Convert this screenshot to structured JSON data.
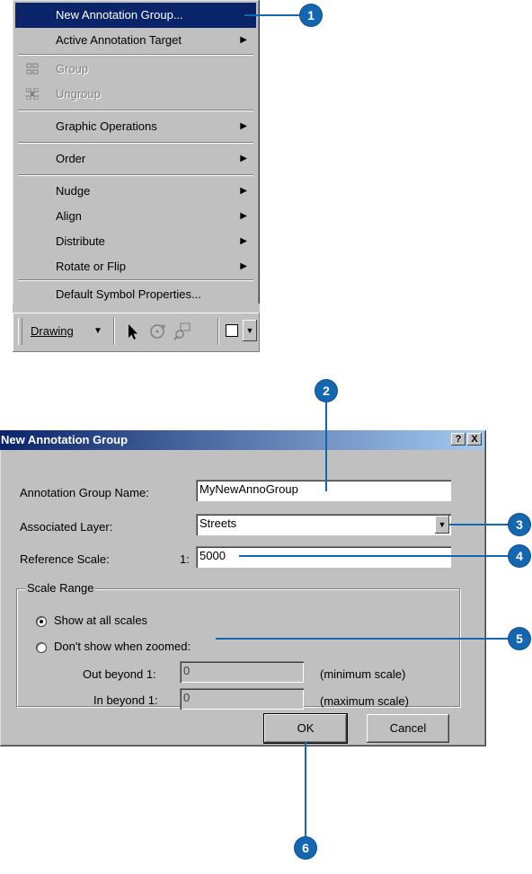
{
  "menu": {
    "items": [
      {
        "label": "New Annotation Group...",
        "state": "highlighted"
      },
      {
        "label": "Active Annotation Target",
        "submenu": true
      },
      {
        "label": "Group",
        "state": "disabled",
        "icon": "group-icon"
      },
      {
        "label": "Ungroup",
        "state": "disabled",
        "icon": "ungroup-icon"
      },
      {
        "label": "Graphic Operations",
        "submenu": true
      },
      {
        "label": "Order",
        "submenu": true
      },
      {
        "label": "Nudge",
        "submenu": true
      },
      {
        "label": "Align",
        "submenu": true
      },
      {
        "label": "Distribute",
        "submenu": true
      },
      {
        "label": "Rotate or Flip",
        "submenu": true
      },
      {
        "label": "Default Symbol Properties..."
      }
    ],
    "submenu_arrow": "▶"
  },
  "toolbar": {
    "drawing_label": "Drawing",
    "drawing_arrow": "▼",
    "tools": [
      "select-arrow-icon",
      "rotate-icon",
      "zoom-to-element-icon",
      "rectangle-icon"
    ]
  },
  "dialog": {
    "title": "New Annotation Group",
    "help_button": "?",
    "close_button": "X",
    "name_label": "Annotation Group Name:",
    "name_value": "MyNewAnnoGroup",
    "layer_label": "Associated Layer:",
    "layer_value": "Streets",
    "scale_label": "Reference Scale:",
    "scale_prefix": "1:",
    "scale_value": "5000",
    "scale_range_title": "Scale Range",
    "radio_all": "Show at all scales",
    "radio_zoom": "Don't show when zoomed:",
    "out_beyond_label": "Out beyond 1:",
    "out_beyond_value": "0",
    "out_beyond_note": "(minimum scale)",
    "in_beyond_label": "In beyond 1:",
    "in_beyond_value": "0",
    "in_beyond_note": "(maximum scale)",
    "ok": "OK",
    "cancel": "Cancel"
  },
  "callouts": [
    "1",
    "2",
    "3",
    "4",
    "5",
    "6"
  ],
  "colors": {
    "callout": "#1566b0",
    "highlight": "#0a246a",
    "face": "#c0c0c0"
  }
}
